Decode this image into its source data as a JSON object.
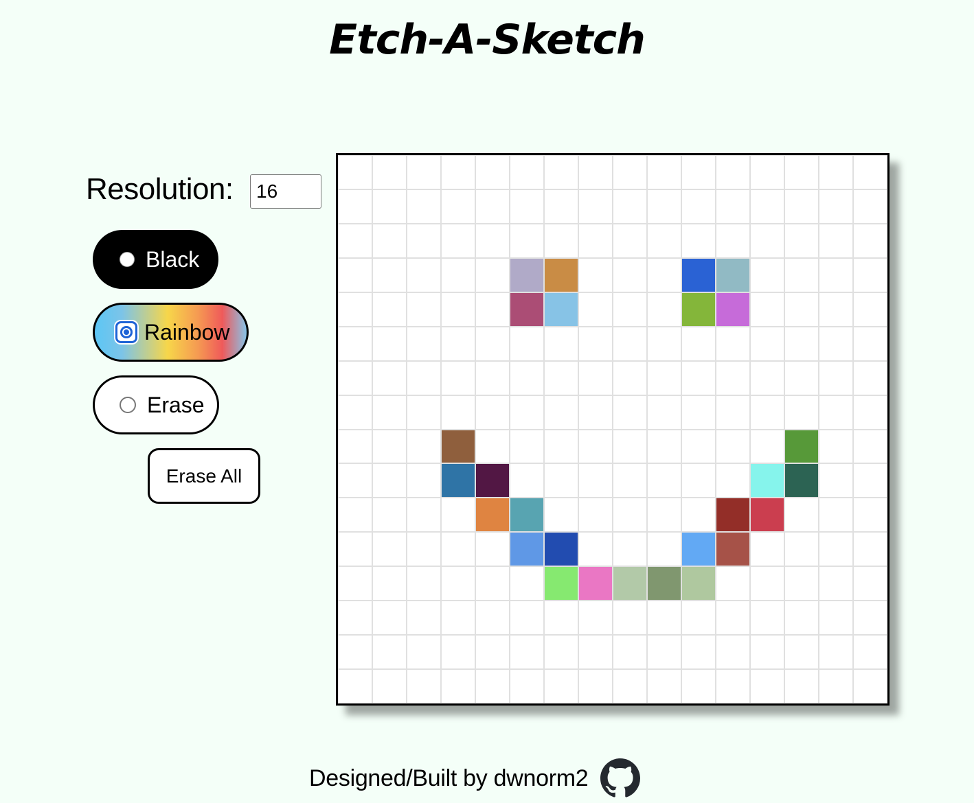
{
  "header": {
    "title": "Etch-A-Sketch"
  },
  "controls": {
    "resolution_label": "Resolution:",
    "resolution_value": "16",
    "modes": [
      {
        "label": "Black",
        "selected": false
      },
      {
        "label": "Rainbow",
        "selected": true
      },
      {
        "label": "Erase",
        "selected": false
      }
    ],
    "erase_all_label": "Erase All"
  },
  "board": {
    "resolution": 16,
    "painted_cells": [
      {
        "row": 3,
        "col": 5,
        "color": "#b0aac8"
      },
      {
        "row": 3,
        "col": 6,
        "color": "#c98c45"
      },
      {
        "row": 4,
        "col": 5,
        "color": "#ab4d75"
      },
      {
        "row": 4,
        "col": 6,
        "color": "#87c3e6"
      },
      {
        "row": 3,
        "col": 10,
        "color": "#2a62d4"
      },
      {
        "row": 3,
        "col": 11,
        "color": "#91bac4"
      },
      {
        "row": 4,
        "col": 10,
        "color": "#84b63a"
      },
      {
        "row": 4,
        "col": 11,
        "color": "#c66bd9"
      },
      {
        "row": 8,
        "col": 3,
        "color": "#8f5f3d"
      },
      {
        "row": 9,
        "col": 3,
        "color": "#2f74a6"
      },
      {
        "row": 9,
        "col": 4,
        "color": "#521744"
      },
      {
        "row": 10,
        "col": 4,
        "color": "#df8441"
      },
      {
        "row": 10,
        "col": 5,
        "color": "#58a4b1"
      },
      {
        "row": 11,
        "col": 5,
        "color": "#5f98e6"
      },
      {
        "row": 11,
        "col": 6,
        "color": "#224cb0"
      },
      {
        "row": 12,
        "col": 6,
        "color": "#86e970"
      },
      {
        "row": 12,
        "col": 7,
        "color": "#ea77c4"
      },
      {
        "row": 12,
        "col": 8,
        "color": "#b2c9a8"
      },
      {
        "row": 12,
        "col": 9,
        "color": "#80976f"
      },
      {
        "row": 12,
        "col": 10,
        "color": "#afc89f"
      },
      {
        "row": 11,
        "col": 10,
        "color": "#62a9f4"
      },
      {
        "row": 11,
        "col": 11,
        "color": "#a65248"
      },
      {
        "row": 10,
        "col": 11,
        "color": "#932e28"
      },
      {
        "row": 10,
        "col": 12,
        "color": "#cb3e4f"
      },
      {
        "row": 9,
        "col": 12,
        "color": "#86f4ec"
      },
      {
        "row": 9,
        "col": 13,
        "color": "#2c6353"
      },
      {
        "row": 8,
        "col": 13,
        "color": "#579939"
      }
    ]
  },
  "footer": {
    "credit": "Designed/Built by dwnorm2",
    "icon": "github-icon"
  }
}
